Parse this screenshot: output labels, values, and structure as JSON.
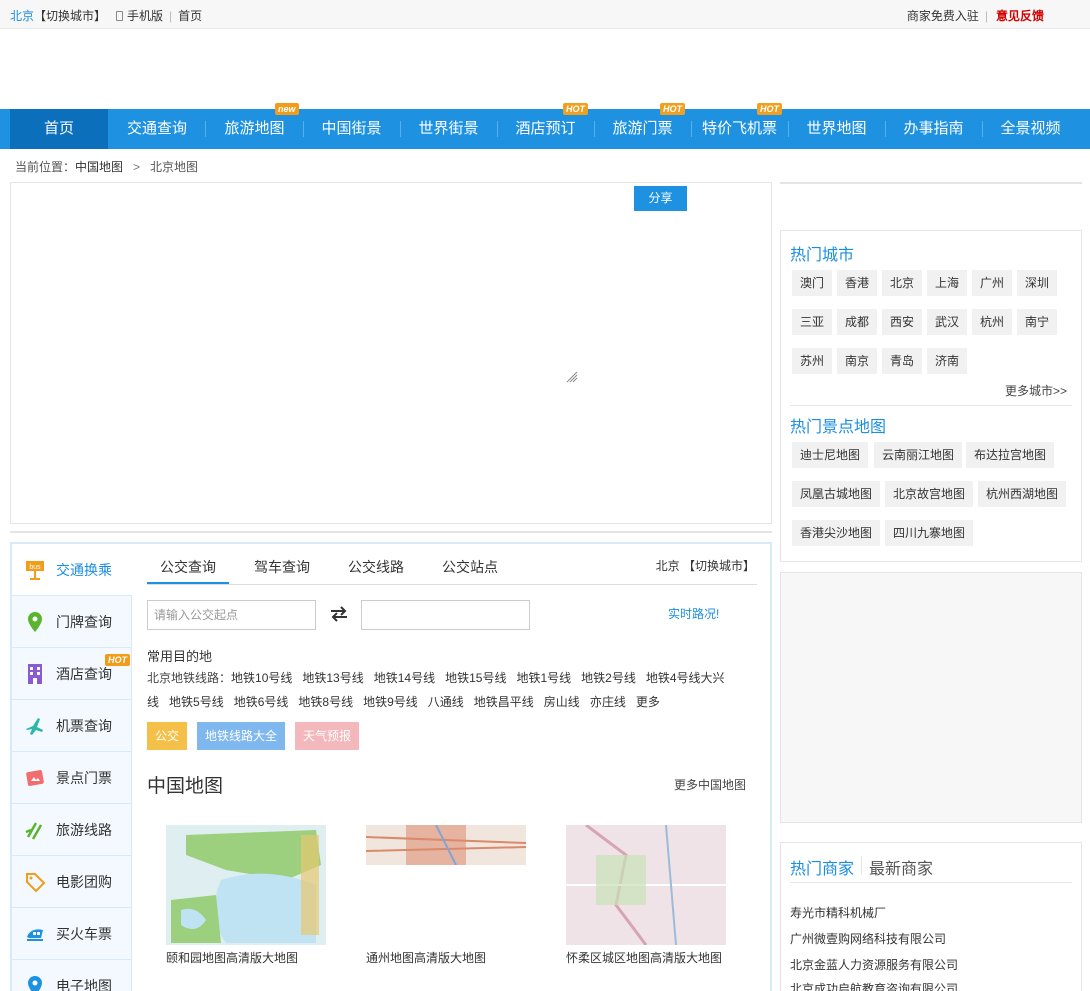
{
  "topbar": {
    "city": "北京",
    "switch_city": "【切换城市】",
    "mobile": "手机版",
    "home": "首页",
    "merchant_join": "商家免费入驻",
    "feedback": "意见反馈"
  },
  "nav": {
    "items": [
      {
        "label": "首页"
      },
      {
        "label": "交通查询"
      },
      {
        "label": "旅游地图",
        "badge": "new"
      },
      {
        "label": "中国街景"
      },
      {
        "label": "世界街景"
      },
      {
        "label": "酒店预订",
        "badge": "HOT"
      },
      {
        "label": "旅游门票",
        "badge": "HOT"
      },
      {
        "label": "特价飞机票",
        "badge": "HOT"
      },
      {
        "label": "世界地图"
      },
      {
        "label": "办事指南"
      },
      {
        "label": "全景视频"
      }
    ]
  },
  "breadcrumb": {
    "prefix": "当前位置：",
    "level1": "中国地图",
    "sep": ">",
    "level2": "北京地图"
  },
  "map": {
    "share_label": "分享"
  },
  "sidebar": {
    "items": [
      {
        "label": "交通换乘",
        "icon": "bus-icon"
      },
      {
        "label": "门牌查询",
        "icon": "location-pin-icon"
      },
      {
        "label": "酒店查询",
        "icon": "hotel-icon",
        "badge": "HOT"
      },
      {
        "label": "机票查询",
        "icon": "plane-icon"
      },
      {
        "label": "景点门票",
        "icon": "ticket-icon"
      },
      {
        "label": "旅游线路",
        "icon": "route-icon"
      },
      {
        "label": "电影团购",
        "icon": "tag-icon"
      },
      {
        "label": "买火车票",
        "icon": "train-icon"
      },
      {
        "label": "电子地图",
        "icon": "map-pin-icon"
      }
    ]
  },
  "transit": {
    "tabs": [
      "公交查询",
      "驾车查询",
      "公交线路",
      "公交站点"
    ],
    "city_label": "北京 【切换城市】",
    "start_placeholder": "请输入公交起点",
    "end_placeholder": "",
    "realtime": "实时路况!",
    "common_title": "常用目的地",
    "lines_prefix": "北京地铁线路：",
    "lines": [
      "地铁10号线",
      "地铁13号线",
      "地铁14号线",
      "地铁15号线",
      "地铁1号线",
      "地铁2号线",
      "地铁4号线大兴",
      "线",
      "地铁5号线",
      "地铁6号线",
      "地铁8号线",
      "地铁9号线",
      "八通线",
      "地铁昌平线",
      "房山线",
      "亦庄线",
      "更多"
    ],
    "buttons": [
      {
        "label": "公交",
        "color": "#f5c04a"
      },
      {
        "label": "地铁线路大全",
        "color": "#7fb7ef"
      },
      {
        "label": "天气预报",
        "color": "#f2b8bb"
      }
    ]
  },
  "china_map": {
    "title": "中国地图",
    "more": "更多中国地图",
    "items": [
      {
        "caption": "颐和园地图高清版大地图"
      },
      {
        "caption": "通州地图高清版大地图"
      },
      {
        "caption": "怀柔区城区地图高清版大地图"
      }
    ]
  },
  "hot_cities": {
    "title": "热门城市",
    "cities": [
      "澳门",
      "香港",
      "北京",
      "上海",
      "广州",
      "深圳",
      "三亚",
      "成都",
      "西安",
      "武汉",
      "杭州",
      "南宁",
      "苏州",
      "南京",
      "青岛",
      "济南"
    ],
    "more": "更多城市>>"
  },
  "hot_spots": {
    "title": "热门景点地图",
    "spots": [
      "迪士尼地图",
      "云南丽江地图",
      "布达拉宫地图",
      "凤凰古城地图",
      "北京故宫地图",
      "杭州西湖地图",
      "香港尖沙地图",
      "四川九寨地图"
    ]
  },
  "merchants": {
    "tab_hot": "热门商家",
    "tab_new": "最新商家",
    "list": [
      "寿光市精科机械厂",
      "广州微壹购网络科技有限公司",
      "北京金蓝人力资源服务有限公司",
      "北京成功启航教育咨询有限公司"
    ]
  }
}
